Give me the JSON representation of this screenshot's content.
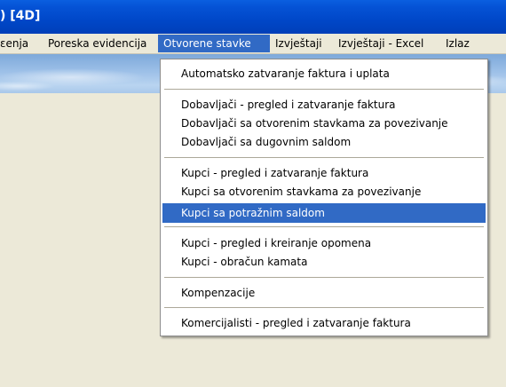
{
  "window": {
    "title": ") [4D]"
  },
  "menubar": {
    "items": [
      {
        "label": "ɛenja"
      },
      {
        "label": "Poreska evidencija"
      },
      {
        "label": "Otvorene stavke",
        "active": true
      },
      {
        "label": "Izvještaji"
      },
      {
        "label": "Izvještaji - Excel"
      },
      {
        "label": "Izlaz"
      }
    ]
  },
  "dropdown": {
    "groups": [
      [
        {
          "label": "Automatsko zatvaranje faktura i uplata"
        }
      ],
      [
        {
          "label": "Dobavljači - pregled i zatvaranje faktura"
        },
        {
          "label": "Dobavljači sa otvorenim stavkama za povezivanje"
        },
        {
          "label": "Dobavljači sa dugovnim saldom"
        }
      ],
      [
        {
          "label": "Kupci - pregled i zatvaranje faktura"
        },
        {
          "label": "Kupci sa otvorenim stavkama za povezivanje"
        },
        {
          "label": "Kupci sa potražnim saldom",
          "selected": true
        }
      ],
      [
        {
          "label": "Kupci - pregled i kreiranje opomena"
        },
        {
          "label": "Kupci - obračun kamata"
        }
      ],
      [
        {
          "label": "Kompenzacije"
        }
      ],
      [
        {
          "label": "Komercijalisti - pregled i zatvaranje faktura"
        }
      ]
    ]
  },
  "colors": {
    "titlebar": "#0054e3",
    "menu_highlight": "#316ac5",
    "window_background": "#ece9d8"
  }
}
